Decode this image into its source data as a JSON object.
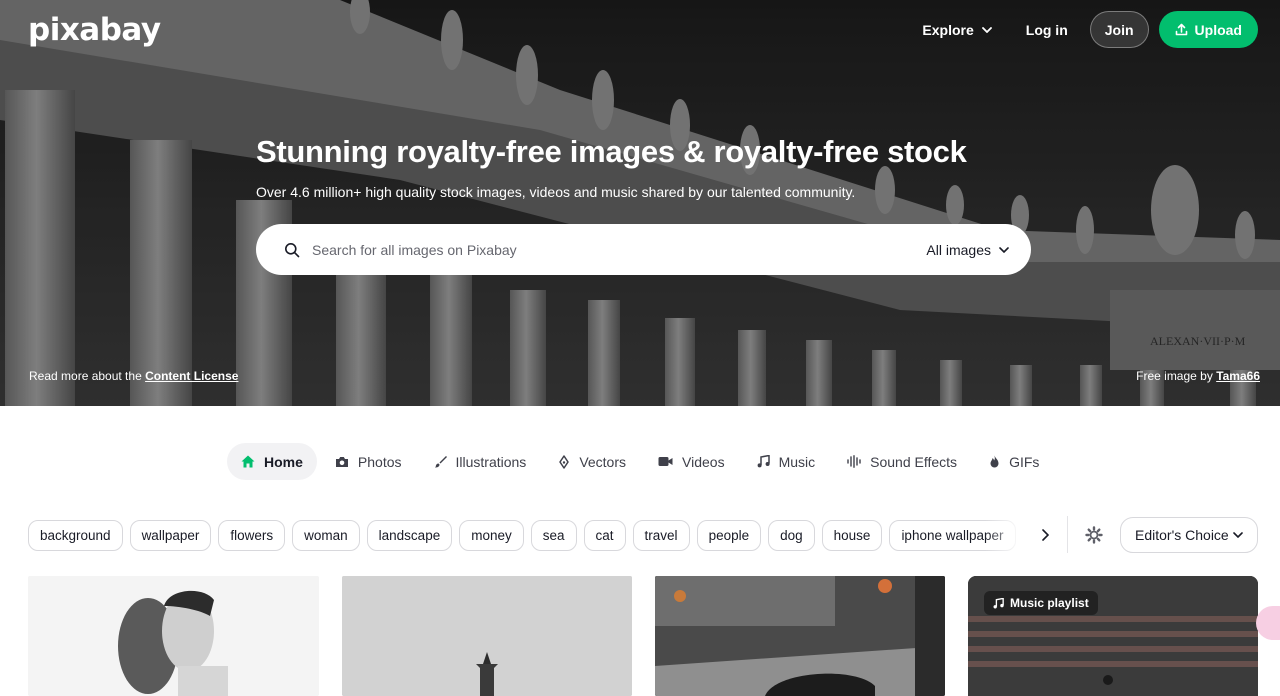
{
  "brand": {
    "logo": "pixabay"
  },
  "topnav": {
    "explore": "Explore",
    "login": "Log in",
    "join": "Join",
    "upload": "Upload"
  },
  "hero": {
    "title": "Stunning royalty-free images & royalty-free stock",
    "subtitle": "Over 4.6 million+ high quality stock images, videos and music shared by our talented community.",
    "license_prefix": "Read more about the",
    "license_link": "Content License",
    "credit_prefix": "Free image by",
    "credit_author": "Tama66"
  },
  "search": {
    "placeholder": "Search for all images on Pixabay",
    "type": "All images"
  },
  "tabs": [
    {
      "label": "Home",
      "icon": "home-icon"
    },
    {
      "label": "Photos",
      "icon": "camera-icon"
    },
    {
      "label": "Illustrations",
      "icon": "brush-icon"
    },
    {
      "label": "Vectors",
      "icon": "pen-nib-icon"
    },
    {
      "label": "Videos",
      "icon": "video-icon"
    },
    {
      "label": "Music",
      "icon": "music-note-icon"
    },
    {
      "label": "Sound Effects",
      "icon": "waveform-icon"
    },
    {
      "label": "GIFs",
      "icon": "flame-icon"
    }
  ],
  "tags": [
    "background",
    "wallpaper",
    "flowers",
    "woman",
    "landscape",
    "money",
    "sea",
    "cat",
    "travel",
    "people",
    "dog",
    "house",
    "iphone wallpaper"
  ],
  "filter": {
    "sort": "Editor's Choice"
  },
  "cards": {
    "playlist_badge": "Music playlist"
  },
  "colors": {
    "accent": "#02be6e",
    "text": "#191b26"
  }
}
